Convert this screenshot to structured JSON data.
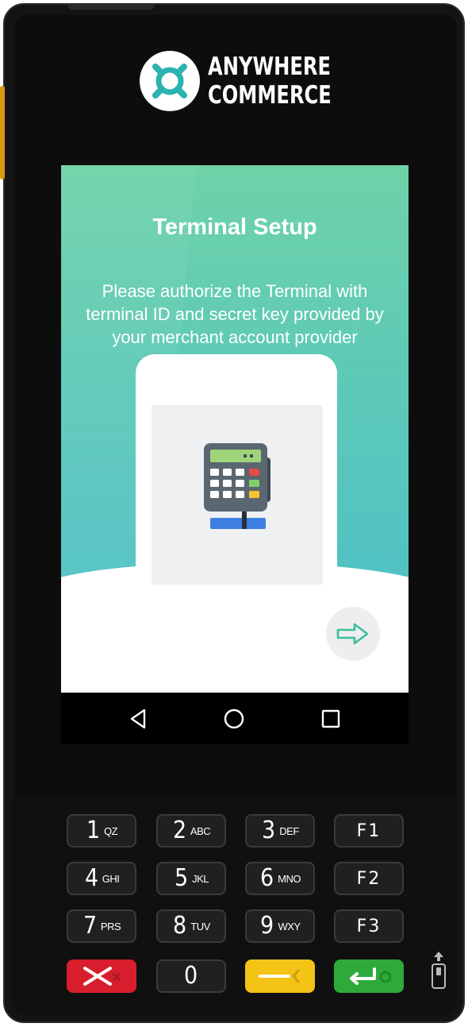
{
  "brand": {
    "line1": "ANYWHERE",
    "line2": "COMMERCE"
  },
  "screen": {
    "title": "Terminal Setup",
    "message": "Please authorize the Terminal with terminal ID and secret key provided by your merchant account provider"
  },
  "keypad": {
    "rows": [
      [
        {
          "num": "1",
          "letters": "QZ"
        },
        {
          "num": "2",
          "letters": "ABC"
        },
        {
          "num": "3",
          "letters": "DEF"
        },
        {
          "fkey": "F1"
        }
      ],
      [
        {
          "num": "4",
          "letters": "GHI"
        },
        {
          "num": "5",
          "letters": "JKL"
        },
        {
          "num": "6",
          "letters": "MNO"
        },
        {
          "fkey": "F2"
        }
      ],
      [
        {
          "num": "7",
          "letters": "PRS"
        },
        {
          "num": "8",
          "letters": "TUV"
        },
        {
          "num": "9",
          "letters": "WXY"
        },
        {
          "fkey": "F3"
        }
      ]
    ],
    "zero": "0"
  },
  "icons": {
    "logo": "anywhere-commerce-logo",
    "illustration": "payment-terminal-icon",
    "next": "arrow-right-icon",
    "back": "back-triangle-icon",
    "home": "home-circle-icon",
    "recents": "recents-square-icon",
    "cancel": "cancel-x-icon",
    "clear": "clear-backspace-icon",
    "enter": "enter-return-icon",
    "usb": "usb-icon"
  },
  "colors": {
    "gradient_top": "#6fd2a8",
    "gradient_bottom": "#4fc1c6",
    "accent": "#3dbf9c",
    "cancel": "#d81e2c",
    "clear": "#f3c316",
    "enter": "#2eaa3a",
    "side_button": "#d49a10"
  }
}
